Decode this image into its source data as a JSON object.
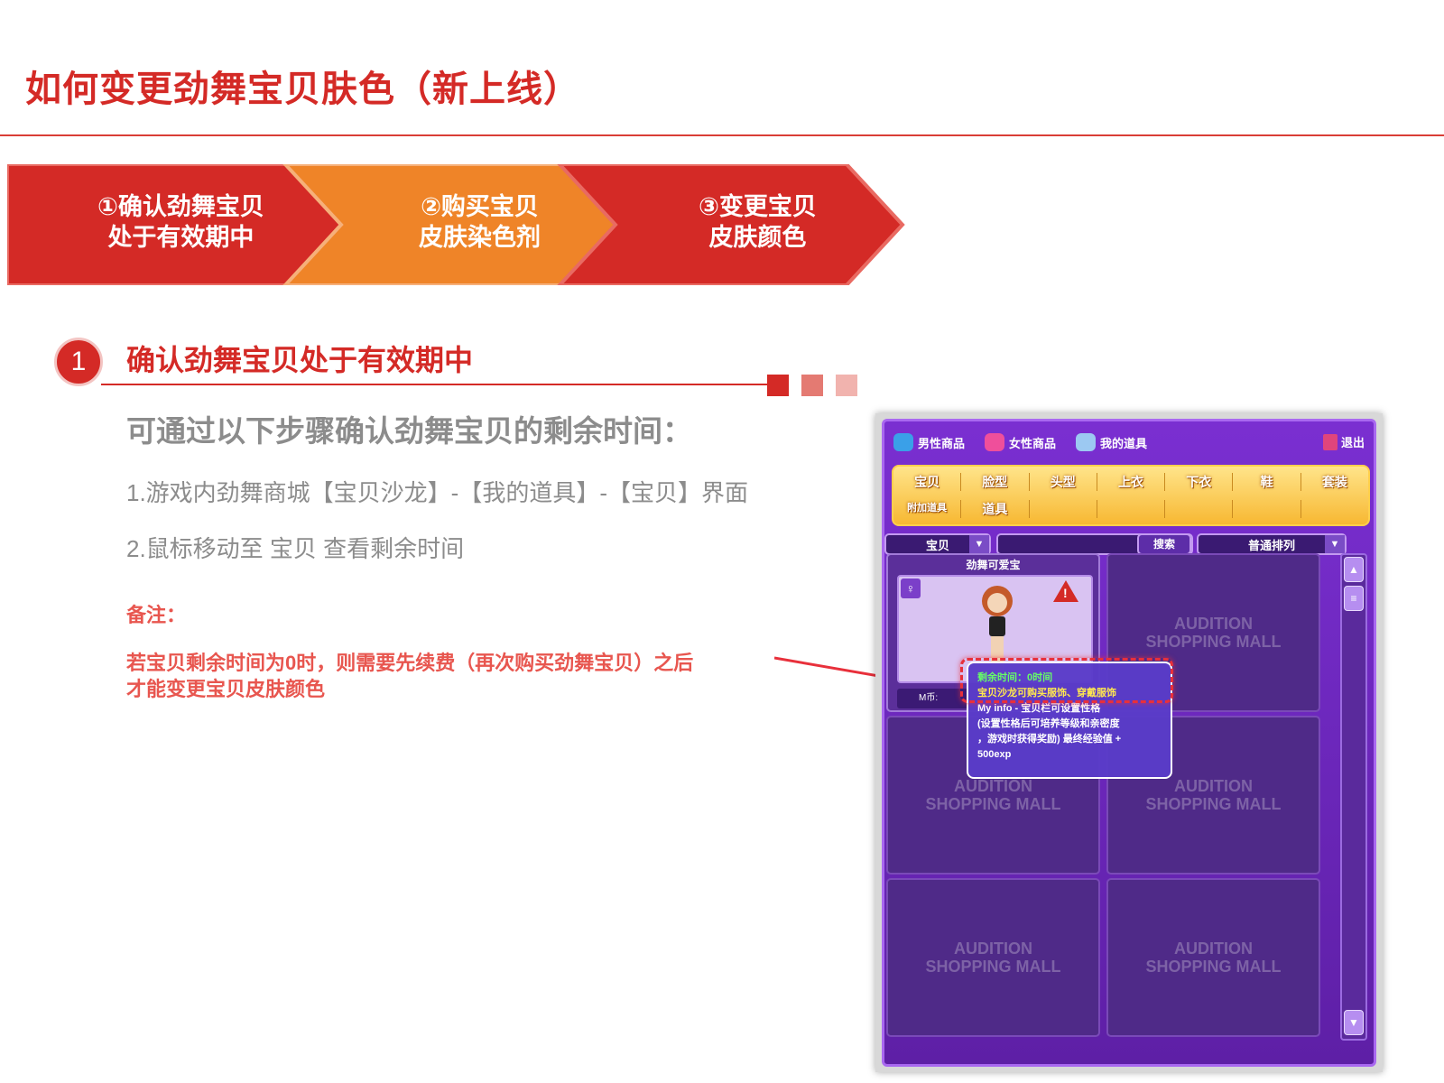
{
  "page": {
    "title": "如何变更劲舞宝贝肤色（新上线）"
  },
  "steps": [
    {
      "line1": "①确认劲舞宝贝",
      "line2": "处于有效期中"
    },
    {
      "line1": "②购买宝贝",
      "line2": "皮肤染色剂"
    },
    {
      "line1": "③变更宝贝",
      "line2": "皮肤颜色"
    }
  ],
  "colors": {
    "accent_red": "#d42a26",
    "step_orange": "#ef8428",
    "note_red": "#e8564f",
    "body_gray": "#8c8c8c"
  },
  "section": {
    "number": "1",
    "heading": "确认劲舞宝贝处于有效期中",
    "subtitle": "可通过以下步骤确认劲舞宝贝的剩余时间：",
    "step1": "1.游戏内劲舞商城【宝贝沙龙】-【我的道具】-【宝贝】界面",
    "step2": "2.鼠标移动至 宝贝 查看剩余时间",
    "note_label": "备注：",
    "note_line1": "若宝贝剩余时间为0时，则需要先续费（再次购买劲舞宝贝）之后",
    "note_line2": "才能变更宝贝皮肤颜色"
  },
  "game": {
    "tabs": [
      {
        "label": "男性商品",
        "icon": "male-items-icon"
      },
      {
        "label": "女性商品",
        "icon": "female-items-icon"
      },
      {
        "label": "我的道具",
        "icon": "my-items-icon"
      }
    ],
    "exit_label": "退出",
    "categories_row1": [
      "宝贝",
      "脸型",
      "头型",
      "上衣",
      "下衣",
      "鞋",
      "套装"
    ],
    "categories_row2": [
      "附加道具",
      "道具",
      "",
      "",
      "",
      "",
      ""
    ],
    "filter_left": "宝贝",
    "search_label": "搜索",
    "sort_label": "普通排列",
    "item_name": "劲舞可爱宝",
    "item_price_label": "M币:",
    "placeholder_line1": "AUDITION",
    "placeholder_line2": "SHOPPING MALL",
    "tooltip": {
      "line1": "剩余时间：0时间",
      "line2": "宝贝沙龙可购买服饰、穿戴服饰",
      "line3": "My info - 宝贝栏可设置性格",
      "line4": "(设置性格后可培养等级和亲密度",
      "line5": "，游戏时获得奖励) 最终经验值 +",
      "line6": "500exp"
    }
  }
}
